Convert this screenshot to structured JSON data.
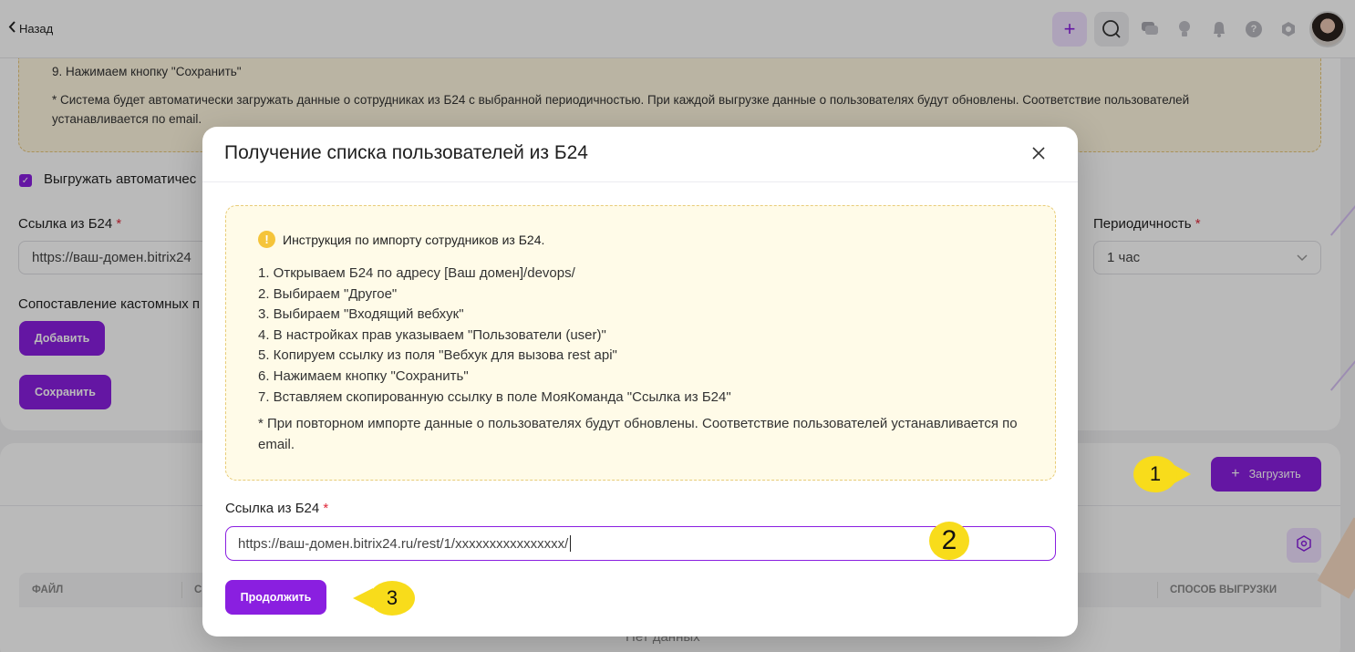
{
  "topbar": {
    "back_label": "Назад",
    "icons": [
      "plus-icon",
      "search-icon",
      "chat-icon",
      "lightbulb-icon",
      "bell-icon",
      "help-icon",
      "settings-icon"
    ]
  },
  "settings_card": {
    "info_step9": "9. Нажимаем кнопку \"Сохранить\"",
    "info_note": "* Система будет автоматически загружать данные о сотрудниках из Б24 с выбранной периодичностью. При каждой выгрузке данные о пользователях будут обновлены. Соответствие пользователей устанавливается по email.",
    "auto_export_label": "Выгружать автоматичес",
    "link_label": "Ссылка из Б24",
    "link_value": "https://ваш-домен.bitrix24",
    "period_label": "Периодичность",
    "period_value": "1 час",
    "mapping_label": "Сопоставление кастомных п",
    "add_button": "Добавить",
    "save_button": "Сохранить"
  },
  "files_card": {
    "upload_button": "Загрузить",
    "columns": [
      "ФАЙЛ",
      "С",
      "СПОСОБ ВЫГРУЗКИ"
    ],
    "empty_text": "Нет данных"
  },
  "modal": {
    "title": "Получение списка пользователей из Б24",
    "instruction_title": "Инструкция по импорту сотрудников из Б24.",
    "steps": [
      "1. Открываем Б24 по адресу [Ваш домен]/devops/",
      "2. Выбираем \"Другое\"",
      "3. Выбираем \"Входящий вебхук\"",
      "4. В настройках прав указываем \"Пользователи (user)\"",
      "5. Копируем ссылку из поля \"Вебхук для вызова rest api\"",
      "6. Нажимаем кнопку \"Сохранить\"",
      "7. Вставляем скопированную ссылку в поле МояКоманда \"Ссылка из Б24\""
    ],
    "note": "* При повторном импорте данные о пользователях будут обновлены. Соответствие пользователей устанавливается по email.",
    "link_label": "Ссылка из Б24",
    "link_value": "https://ваш-домен.bitrix24.ru/rest/1/xxxxxxxxxxxxxxxx/",
    "continue_button": "Продолжить"
  },
  "callouts": [
    "1",
    "2",
    "3"
  ],
  "colors": {
    "accent": "#8a1fe0",
    "callout": "#f8dc1b",
    "info_bg": "#fffbe8"
  }
}
